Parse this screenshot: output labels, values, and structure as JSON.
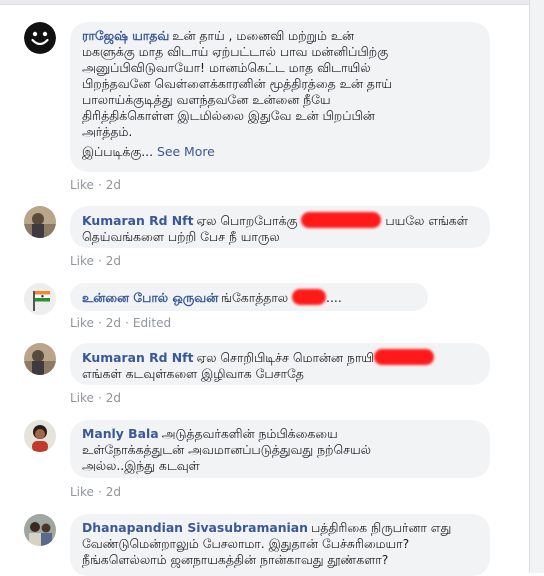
{
  "comments": [
    {
      "author": "ராஜேஷ் யாதவ்",
      "text_lines": [
        "உன் தாய் , மனைவி மற்றும் உன்",
        "மகளுக்கு மாத விடாய் ஏற்பட்டால் பாவ மன்னிப்பிற்கு",
        "அனுப்பிவிடுவாயோ! மானம்கெட்ட மாத விடாயில்",
        "பிறந்தவனே வெள்ளைக்காரனின் மூத்திரத்தை உன் தாய்",
        "பாலாய்க்குடித்து வளந்தவனே உன்னை நீயே",
        "திரித்திக்கொள்ள இடமில்லை இதுவே உன் பிறப்பின்",
        "அர்த்தம்."
      ],
      "truncated_text": "இப்படிக்கு...",
      "see_more": "See More",
      "like": "Like",
      "time": "2d"
    },
    {
      "author": "Kumaran Rd Nft",
      "text_line1_start": "ஏல பொறபோக்கு",
      "text_line1_end": "பயலே எங்கள்",
      "text_line2": "தெய்வங்களை பற்றி பேச நீ யாருல",
      "like": "Like",
      "time": "2d"
    },
    {
      "author": "உன்னை போல் ஒருவன்",
      "text_start": "ங்கோத்தால",
      "text_end": "....",
      "like": "Like",
      "time": "2d",
      "edited": "Edited"
    },
    {
      "author": "Kumaran Rd Nft",
      "text_line1": "ஏல சொறிபிடிச்ச மொன்ன நாயி",
      "text_line2": "எங்கள் கடவுள்களை இழிவாக பேசாதே",
      "like": "Like",
      "time": "2d"
    },
    {
      "author": "Manly Bala",
      "text_lines": [
        "அடுத்தவர்களின் நம்பிக்கையை",
        "உள்நோக்கத்துடன் அவமானப்படுத்துவது நற்செயல்",
        "அல்ல..இந்து கடவுள்"
      ],
      "like": "Like",
      "time": "2d"
    },
    {
      "author": "Dhanapandian Sivasubramanian",
      "text_lines": [
        "பத்திரிகை நிருபர்னா எது",
        "வேண்டுமென்றாலும் பேசலாமா. இதுதான் பேச்சுரிமையா?",
        "நீங்களெல்லாம் ஜனநாயகத்தின் நான்காவது தூண்களா?"
      ]
    }
  ],
  "colors": {
    "link": "#385898",
    "bubble": "#f2f3f5",
    "meta": "#90949c",
    "redaction": "#ff1a1a"
  },
  "icons": [
    "smiley-avatar-icon",
    "profile-photo",
    "india-flag-avatar-icon"
  ]
}
